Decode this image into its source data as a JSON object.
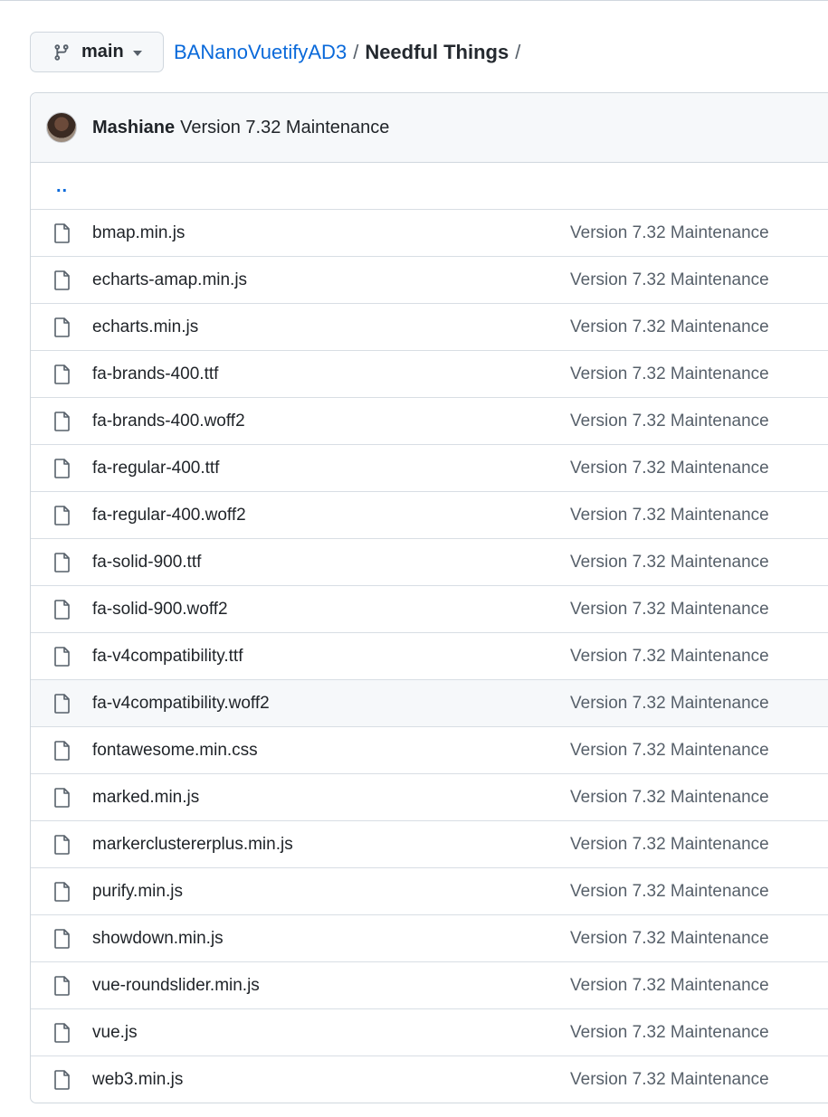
{
  "branch": {
    "label": "main"
  },
  "breadcrumb": {
    "repo": "BANanoVuetifyAD3",
    "separator": "/",
    "folder": "Needful Things",
    "trailing": "/"
  },
  "commit": {
    "author": "Mashiane",
    "message": "Version 7.32 Maintenance"
  },
  "parent_dir": "..",
  "files": [
    {
      "name": "bmap.min.js",
      "commit": "Version 7.32 Maintenance"
    },
    {
      "name": "echarts-amap.min.js",
      "commit": "Version 7.32 Maintenance"
    },
    {
      "name": "echarts.min.js",
      "commit": "Version 7.32 Maintenance"
    },
    {
      "name": "fa-brands-400.ttf",
      "commit": "Version 7.32 Maintenance"
    },
    {
      "name": "fa-brands-400.woff2",
      "commit": "Version 7.32 Maintenance"
    },
    {
      "name": "fa-regular-400.ttf",
      "commit": "Version 7.32 Maintenance"
    },
    {
      "name": "fa-regular-400.woff2",
      "commit": "Version 7.32 Maintenance"
    },
    {
      "name": "fa-solid-900.ttf",
      "commit": "Version 7.32 Maintenance"
    },
    {
      "name": "fa-solid-900.woff2",
      "commit": "Version 7.32 Maintenance"
    },
    {
      "name": "fa-v4compatibility.ttf",
      "commit": "Version 7.32 Maintenance"
    },
    {
      "name": "fa-v4compatibility.woff2",
      "commit": "Version 7.32 Maintenance"
    },
    {
      "name": "fontawesome.min.css",
      "commit": "Version 7.32 Maintenance"
    },
    {
      "name": "marked.min.js",
      "commit": "Version 7.32 Maintenance"
    },
    {
      "name": "markerclustererplus.min.js",
      "commit": "Version 7.32 Maintenance"
    },
    {
      "name": "purify.min.js",
      "commit": "Version 7.32 Maintenance"
    },
    {
      "name": "showdown.min.js",
      "commit": "Version 7.32 Maintenance"
    },
    {
      "name": "vue-roundslider.min.js",
      "commit": "Version 7.32 Maintenance"
    },
    {
      "name": "vue.js",
      "commit": "Version 7.32 Maintenance"
    },
    {
      "name": "web3.min.js",
      "commit": "Version 7.32 Maintenance"
    }
  ],
  "hovered_row_index": 10,
  "icons": {
    "branch": "git-branch-icon",
    "file": "file-icon",
    "dropdown": "caret-down-icon"
  },
  "colors": {
    "link": "#0969da",
    "muted": "#57606a",
    "border": "#d0d7de",
    "header_bg": "#f6f8fa"
  }
}
